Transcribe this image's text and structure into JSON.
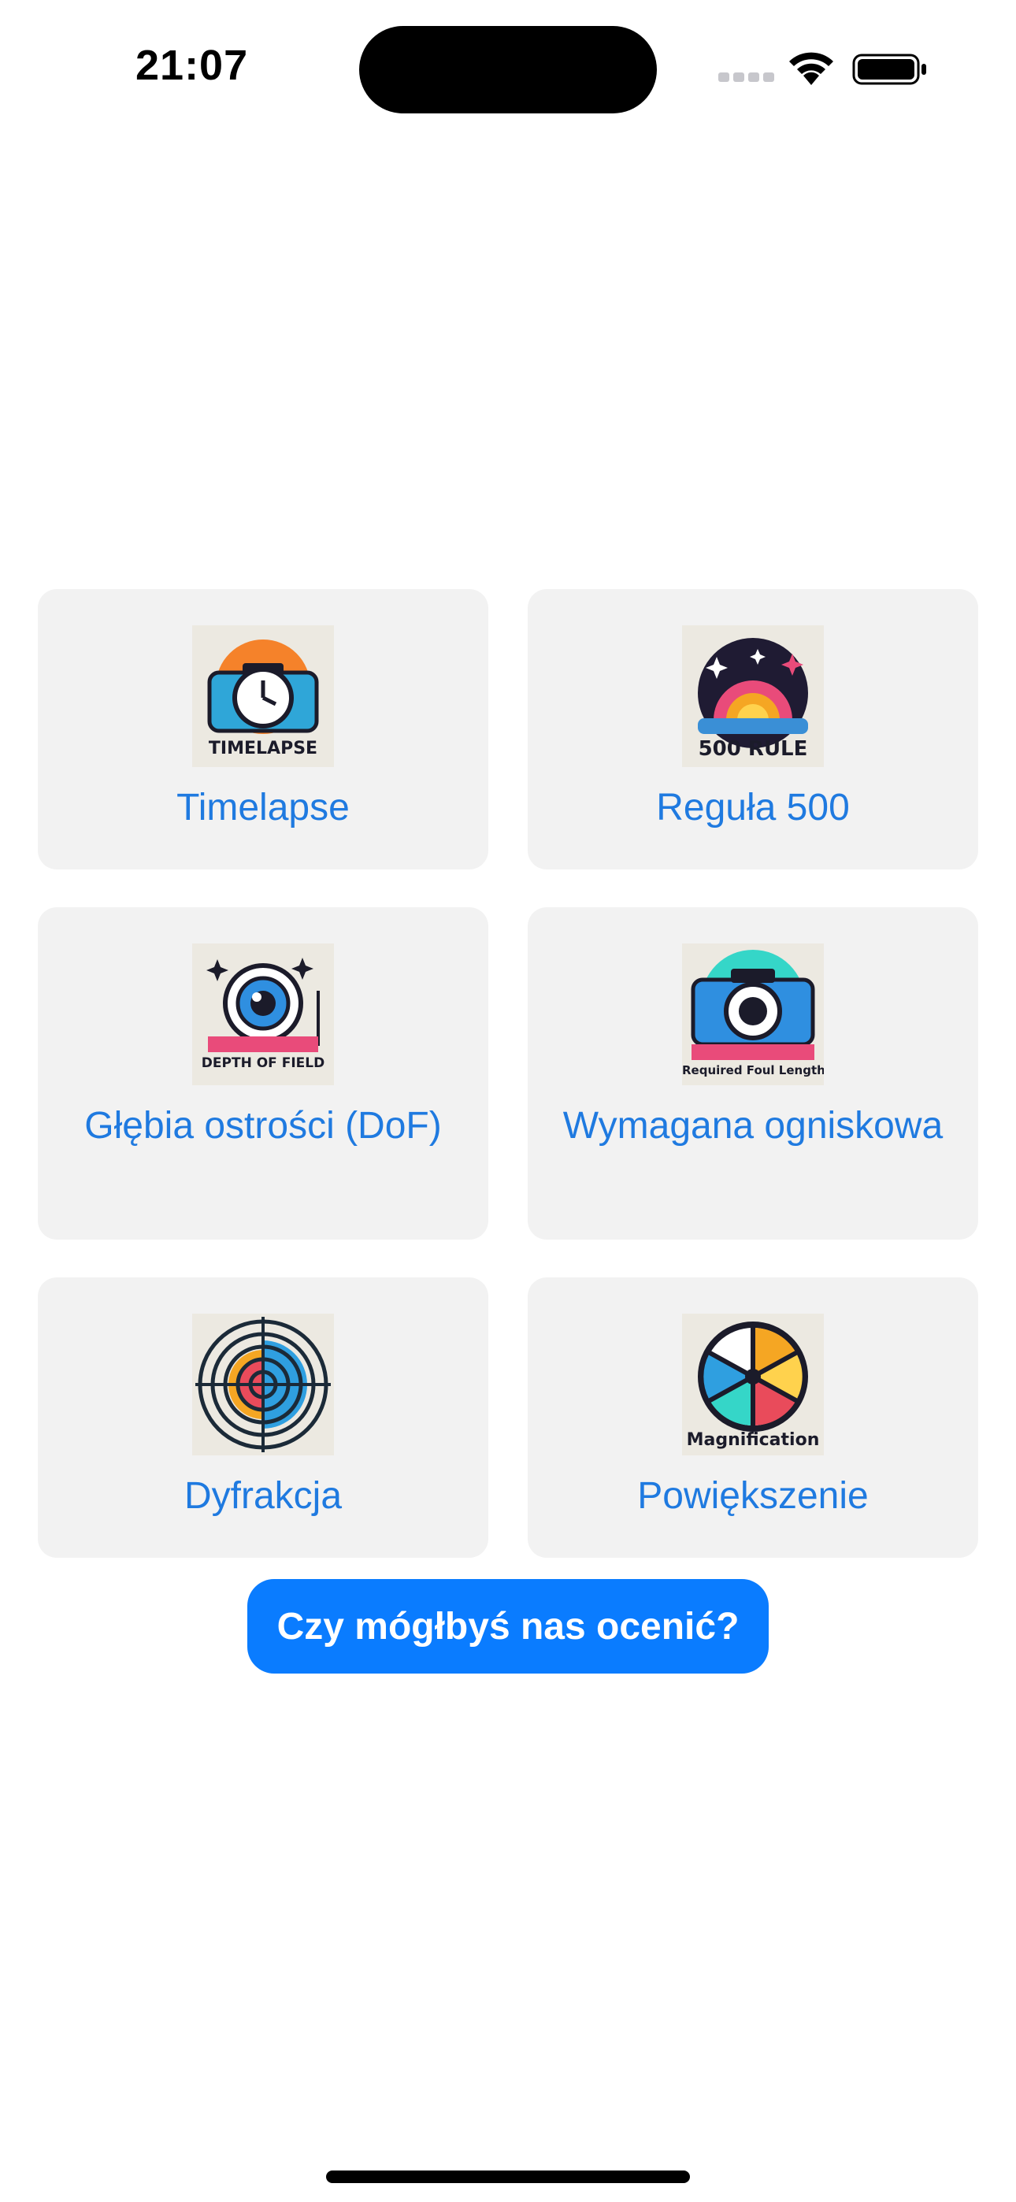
{
  "status_bar": {
    "time": "21:07",
    "icons": [
      "signal-icon",
      "wifi-icon",
      "battery-icon"
    ]
  },
  "tiles": [
    {
      "label": "Timelapse",
      "image_caption": "TIMELAPSE",
      "icon": "timelapse-camera-icon"
    },
    {
      "label": "Reguła 500",
      "image_caption": "500 RULE",
      "icon": "500-rule-icon"
    },
    {
      "label": "Głębia ostrości (DoF)",
      "image_caption": "DEPTH OF FIELD",
      "icon": "depth-of-field-icon"
    },
    {
      "label": "Wymagana ogniskowa",
      "image_caption": "Required Foul Length",
      "icon": "focal-length-camera-icon"
    },
    {
      "label": "Dyfrakcja",
      "image_caption": "",
      "icon": "diffraction-target-icon"
    },
    {
      "label": "Powiększenie",
      "image_caption": "Magnification",
      "icon": "magnification-wheel-icon"
    }
  ],
  "rate_button": {
    "label": "Czy mógłbyś nas ocenić?"
  },
  "colors": {
    "accent": "#0a7cff",
    "tile_label": "#1f7ae0",
    "tile_background": "#f2f2f2"
  }
}
